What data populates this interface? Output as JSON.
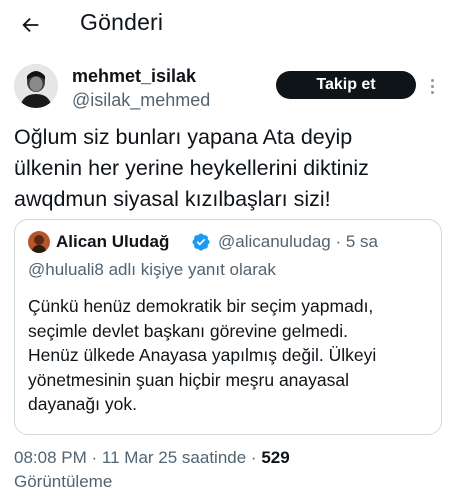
{
  "header": {
    "title": "Gönderi",
    "back_icon": "arrow-left-icon"
  },
  "author": {
    "name": "mehmet_isilak",
    "handle": "@isilak_mehmed",
    "follow_label": "Takip et",
    "more_icon": "more-vertical-icon"
  },
  "tweet": {
    "text": "Oğlum siz bunları yapana Ata deyip\nülkenin her yerine heykellerini diktiniz\nawqdmun siyasal kızılbaşları sizi!"
  },
  "quote": {
    "name": "Alican Uludağ",
    "verified_icon": "verified-badge-icon",
    "handle": "@alicanuludag",
    "separator": "·",
    "time": "5 sa",
    "reply_to": "@huluali8 adlı kişiye yanıt olarak",
    "text": "Çünkü henüz demokratik bir seçim yapmadı,\nseçimle devlet başkanı görevine gelmedi.\nHenüz ülkede Anayasa yapılmış değil. Ülkeyi\nyönetmesinin şuan hiçbir meşru anayasal\ndayanağı yok."
  },
  "meta": {
    "time": "08:08 PM",
    "separator": "·",
    "date": "11 Mar 25 saatinde",
    "views_count": "529",
    "views_label": "Görüntüleme"
  },
  "colors": {
    "text": "#0f1419",
    "secondary": "#536471",
    "border": "#cfd9de",
    "verified": "#1d9bf0",
    "button_bg": "#0f1419"
  }
}
